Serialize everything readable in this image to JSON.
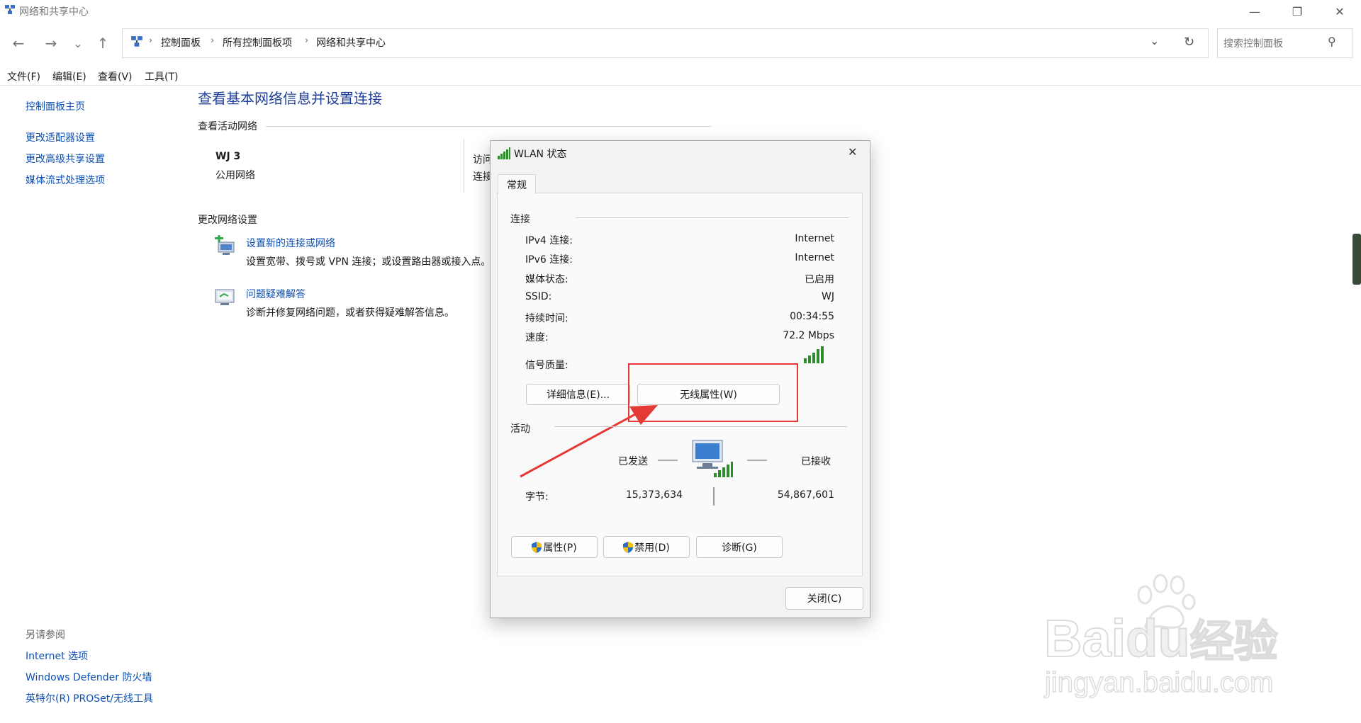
{
  "window": {
    "title": "网络和共享中心",
    "minimize": "—",
    "maximize": "❐",
    "close": "✕"
  },
  "nav": {
    "back": "←",
    "forward": "→",
    "recent": "⌄",
    "up": "↑",
    "breadcrumbs": [
      "控制面板",
      "所有控制面板项",
      "网络和共享中心"
    ],
    "dropdown": "⌄",
    "refresh": "↻",
    "search_placeholder": "搜索控制面板",
    "search_icon": "⚲"
  },
  "menu": [
    "文件(F)",
    "编辑(E)",
    "查看(V)",
    "工具(T)"
  ],
  "left_pane": {
    "home": "控制面板主页",
    "links": [
      "更改适配器设置",
      "更改高级共享设置",
      "媒体流式处理选项"
    ],
    "see_also_title": "另请参阅",
    "see_also": [
      "Internet 选项",
      "Windows Defender 防火墙",
      "英特尔(R) PROSet/无线工具"
    ]
  },
  "main": {
    "title": "查看基本网络信息并设置连接",
    "active_networks_heading": "查看活动网络",
    "network_name": "WJ 3",
    "network_type": "公用网络",
    "access_label": "访问",
    "connect_label": "连接",
    "change_settings_heading": "更改网络设置",
    "tasks": [
      {
        "title": "设置新的连接或网络",
        "desc": "设置宽带、拨号或 VPN 连接；或设置路由器或接入点。"
      },
      {
        "title": "问题疑难解答",
        "desc": "诊断并修复网络问题，或者获得疑难解答信息。"
      }
    ]
  },
  "dialog": {
    "title": "WLAN 状态",
    "close": "✕",
    "tab": "常规",
    "connection_heading": "连接",
    "rows": [
      {
        "label": "IPv4 连接:",
        "value": "Internet"
      },
      {
        "label": "IPv6 连接:",
        "value": "Internet"
      },
      {
        "label": "媒体状态:",
        "value": "已启用"
      },
      {
        "label": "SSID:",
        "value": "WJ"
      },
      {
        "label": "持续时间:",
        "value": "00:34:55"
      },
      {
        "label": "速度:",
        "value": "72.2 Mbps"
      }
    ],
    "signal_label": "信号质量:",
    "details_button": "详细信息(E)...",
    "wireless_props_button": "无线属性(W)",
    "activity_heading": "活动",
    "sent_label": "已发送",
    "received_label": "已接收",
    "bytes_label": "字节:",
    "bytes_sent": "15,373,634",
    "bytes_received": "54,867,601",
    "properties_button": "属性(P)",
    "disable_button": "禁用(D)",
    "diagnose_button": "诊断(G)",
    "close_button": "关闭(C)"
  },
  "watermark": {
    "brand_left": "Bai",
    "brand_mid": "du",
    "brand_right": "经验",
    "url": "jingyan.baidu.com"
  },
  "colors": {
    "link": "#0b4fb3",
    "heading": "#1e3e99",
    "annotation": "#e53935",
    "signal": "#2e8b2e"
  }
}
